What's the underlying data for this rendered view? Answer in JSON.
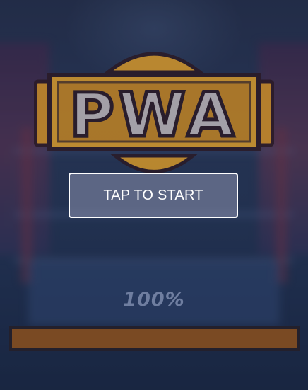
{
  "logo": {
    "text": "PWA",
    "colors": {
      "gold": "#d3962a",
      "plate": "#b9b3b7",
      "outline": "#2a1a26"
    }
  },
  "start_button": {
    "label": "TAP TO START"
  },
  "loading": {
    "progress_text": "100%",
    "progress_value": 1.0,
    "fill_color": "#7a4a23"
  }
}
